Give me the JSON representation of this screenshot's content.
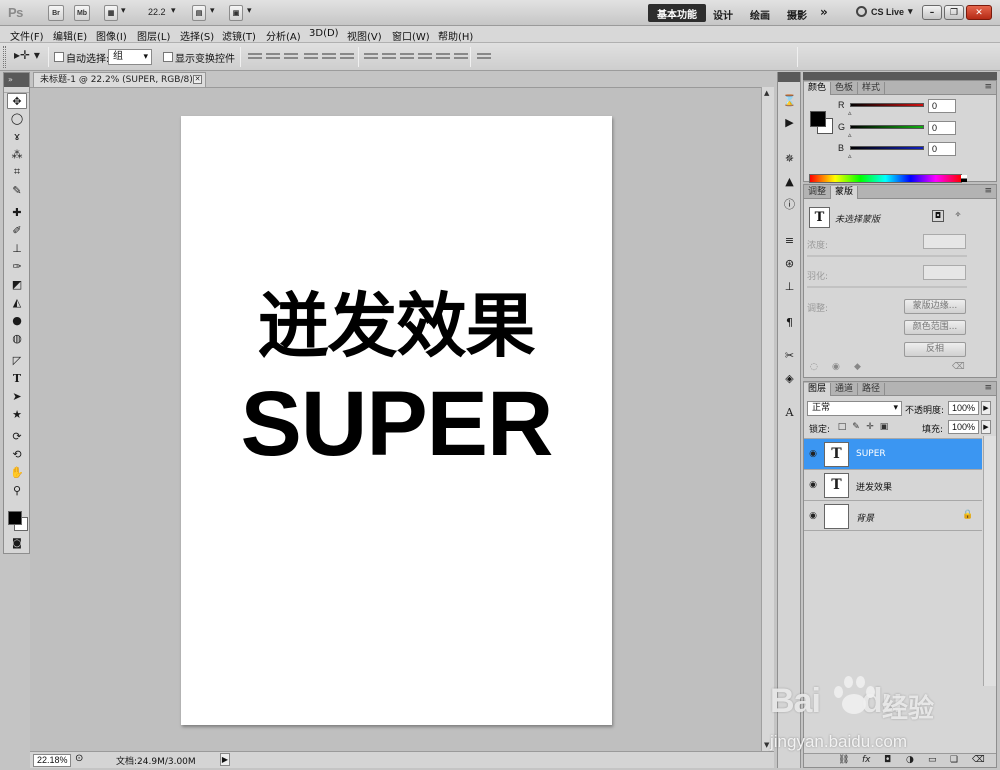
{
  "app": {
    "logo": "Ps",
    "bridge_label": "Br",
    "minibridge_label": "Mb",
    "zoom_select": "22.2",
    "workspaces": {
      "active": "基本功能",
      "items": [
        "设计",
        "绘画",
        "摄影"
      ],
      "more": "»"
    },
    "cs_live": "CS Live"
  },
  "menus": [
    "文件(F)",
    "编辑(E)",
    "图像(I)",
    "图层(L)",
    "选择(S)",
    "滤镜(T)",
    "分析(A)",
    "3D(D)",
    "视图(V)",
    "窗口(W)",
    "帮助(H)"
  ],
  "options": {
    "auto_select_label": "自动选择:",
    "auto_select_value": "组",
    "show_transform_label": "显示变换控件"
  },
  "document": {
    "tab_title": "未标题-1 @ 22.2% (SUPER, RGB/8) *",
    "text_line1": "迸发效果",
    "text_line2": "SUPER",
    "status_zoom": "22.18%",
    "status_doc": "文档:24.9M/3.00M"
  },
  "color_panel": {
    "tabs": [
      "颜色",
      "色板",
      "样式"
    ],
    "channels": [
      {
        "label": "R",
        "value": "0",
        "color": "#d01010"
      },
      {
        "label": "G",
        "value": "0",
        "color": "#10b010"
      },
      {
        "label": "B",
        "value": "0",
        "color": "#1020c0"
      }
    ]
  },
  "mask_panel": {
    "tabs": [
      "调整",
      "蒙版"
    ],
    "no_mask": "未选择蒙版",
    "density": "浓度:",
    "feather": "羽化:",
    "refine": "调整:",
    "mask_edge": "蒙版边缘...",
    "color_range": "颜色范围...",
    "invert": "反相"
  },
  "layers_panel": {
    "tabs": [
      "图层",
      "通道",
      "路径"
    ],
    "blend_mode": "正常",
    "opacity_label": "不透明度:",
    "opacity_value": "100%",
    "lock_label": "锁定:",
    "fill_label": "填充:",
    "fill_value": "100%",
    "layers": [
      {
        "name": "SUPER",
        "thumb": "T",
        "selected": true
      },
      {
        "name": "迸发效果",
        "thumb": "T",
        "selected": false
      },
      {
        "name": "背景",
        "thumb": "",
        "selected": false
      }
    ]
  },
  "watermark": {
    "brand": "Bai",
    "brand2": "du",
    "cn": "经验",
    "url": "jingyan.baidu.com"
  }
}
